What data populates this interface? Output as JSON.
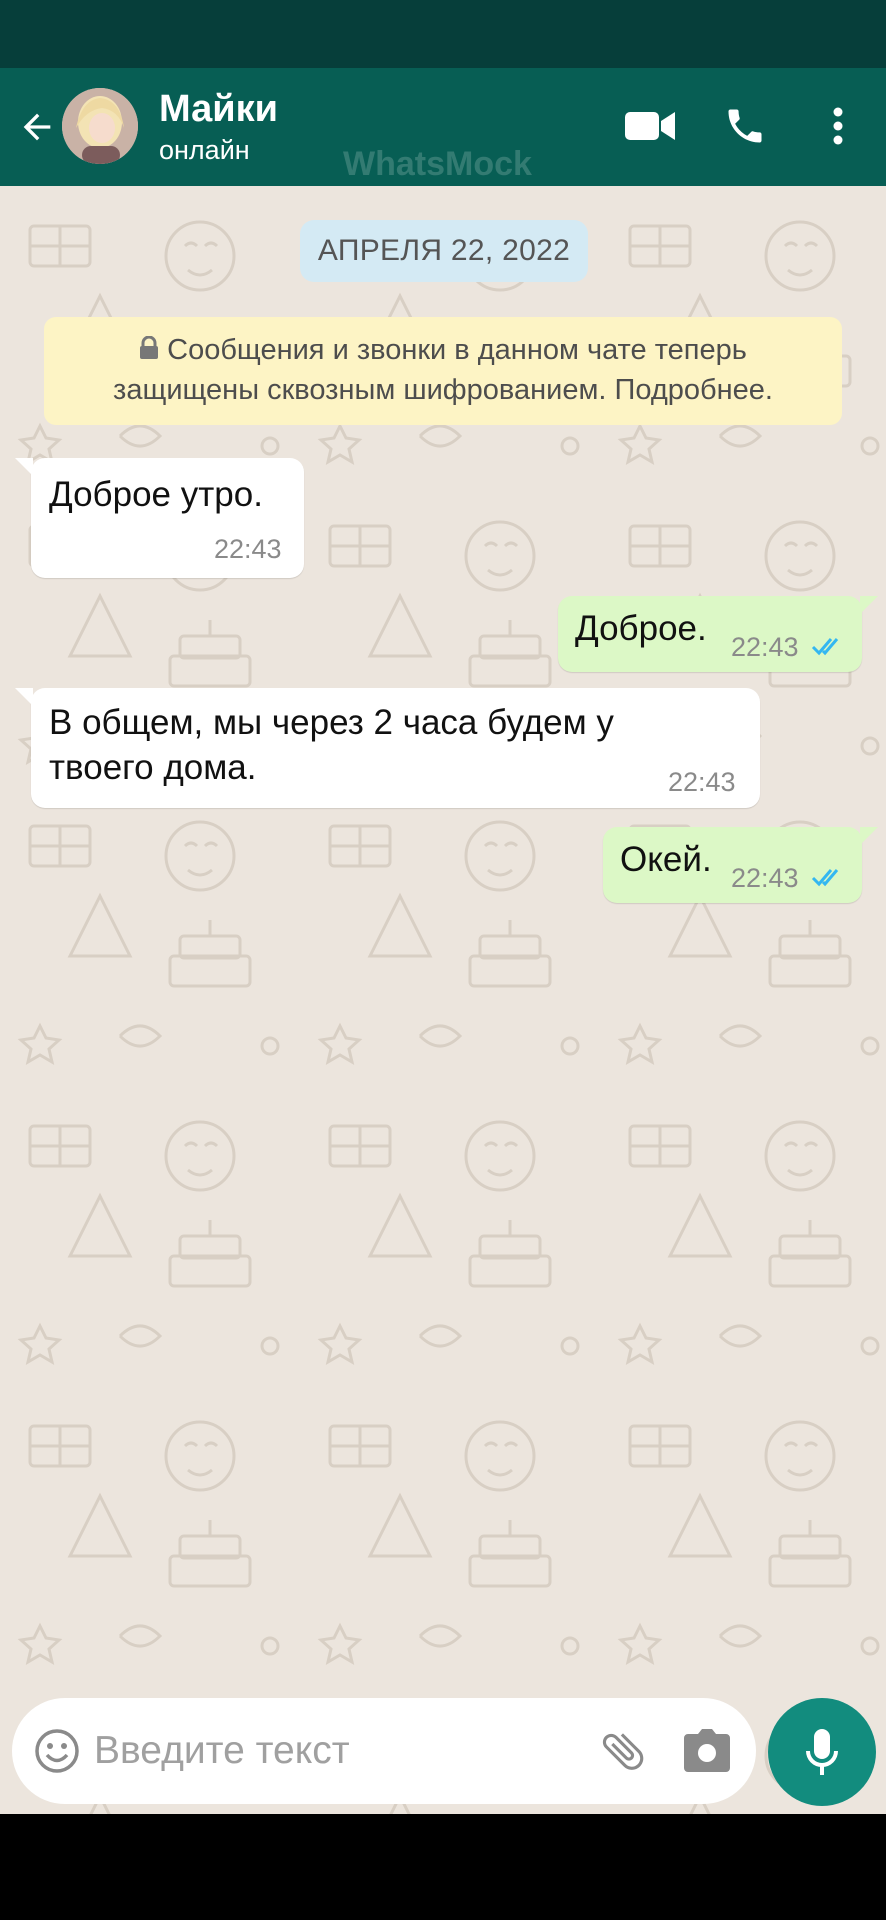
{
  "app": {
    "watermark": "WhatsMock"
  },
  "colors": {
    "header": "#075e54",
    "status_bar": "#063e3a",
    "outgoing_bubble": "#dcf8c6",
    "incoming_bubble": "#ffffff",
    "accent": "#128c7e",
    "read_ticks": "#34b7f1"
  },
  "header": {
    "contact_name": "Майки",
    "contact_status": "онлайн",
    "icons": [
      "back-arrow-icon",
      "video-call-icon",
      "phone-icon",
      "more-vert-icon"
    ]
  },
  "chat": {
    "date_label": "АПРЕЛЯ 22, 2022",
    "encryption_notice": {
      "line1": "Сообщения и звонки в данном чате теперь",
      "line2": "защищены сквозным шифрованием. Подробнее."
    },
    "messages": [
      {
        "direction": "incoming",
        "lines": [
          "Доброе утро."
        ],
        "time": "22:43"
      },
      {
        "direction": "outgoing",
        "lines": [
          "Доброе."
        ],
        "time": "22:43",
        "status": "read"
      },
      {
        "direction": "incoming",
        "lines": [
          "В общем, мы через 2 часа будем у",
          "твоего дома."
        ],
        "time": "22:43"
      },
      {
        "direction": "outgoing",
        "lines": [
          "Окей."
        ],
        "time": "22:43",
        "status": "read"
      }
    ]
  },
  "composer": {
    "placeholder": "Введите текст",
    "icons": [
      "emoji-icon",
      "attach-icon",
      "camera-icon",
      "mic-icon"
    ]
  }
}
